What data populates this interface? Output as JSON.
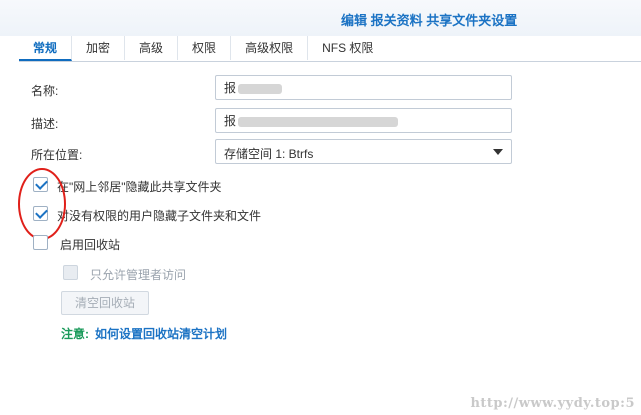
{
  "header": {
    "title": "编辑 报关资料 共享文件夹设置"
  },
  "tabs": [
    {
      "label": "常规",
      "active": true
    },
    {
      "label": "加密"
    },
    {
      "label": "高级"
    },
    {
      "label": "权限"
    },
    {
      "label": "高级权限"
    },
    {
      "label": "NFS 权限"
    }
  ],
  "form": {
    "name_label": "名称:",
    "name_value": "报",
    "desc_label": "描述:",
    "desc_value": "报",
    "location_label": "所在位置:",
    "location_value": "存储空间 1:  Btrfs"
  },
  "options": {
    "hide_network": {
      "label": "在\"网上邻居\"隐藏此共享文件夹",
      "checked": true
    },
    "hide_subfolders": {
      "label": "对没有权限的用户隐藏子文件夹和文件",
      "checked": true
    },
    "recycle_bin": {
      "label": "启用回收站",
      "checked": false
    },
    "admin_only": {
      "label": "只允许管理者访问",
      "checked": false,
      "disabled": true
    }
  },
  "buttons": {
    "clear_recycle": "清空回收站"
  },
  "note": {
    "prefix": "注意:",
    "link": "如何设置回收站清空计划"
  },
  "watermark": "http://www.yydy.top:5",
  "colors": {
    "accent": "#1c73c4",
    "note_green": "#1a9a5a",
    "annotation_red": "#e0201a"
  }
}
